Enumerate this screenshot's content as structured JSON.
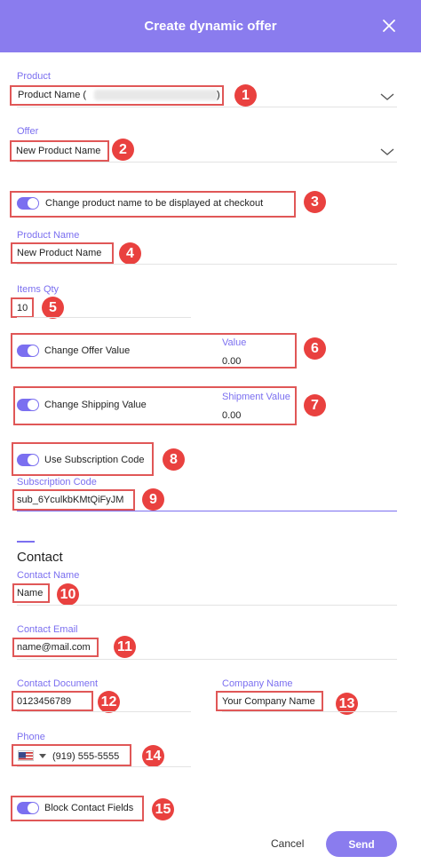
{
  "header": {
    "title": "Create dynamic offer"
  },
  "product": {
    "label": "Product",
    "value": "Product Name ("
  },
  "offer": {
    "label": "Offer",
    "value": "New Product Name"
  },
  "toggles": {
    "change_name": "Change product name to be displayed at checkout",
    "offer_value": "Change Offer Value",
    "shipping_value": "Change Shipping Value",
    "subscription": "Use Subscription Code",
    "block_contact": "Block Contact Fields"
  },
  "product_name": {
    "label": "Product Name",
    "value": "New Product Name"
  },
  "items_qty": {
    "label": "Items Qty",
    "value": "10"
  },
  "value_field": {
    "label": "Value",
    "value": "0.00"
  },
  "shipment_value": {
    "label": "Shipment Value",
    "value": "0.00"
  },
  "subscription_code": {
    "label": "Subscription Code",
    "value": "sub_6YculkbKMtQiFyJM"
  },
  "contact": {
    "title": "Contact"
  },
  "contact_name": {
    "label": "Contact Name",
    "value": "Name"
  },
  "contact_email": {
    "label": "Contact Email",
    "value": "name@mail.com"
  },
  "contact_document": {
    "label": "Contact Document",
    "value": "0123456789"
  },
  "company_name": {
    "label": "Company Name",
    "value": "Your Company Name"
  },
  "phone": {
    "label": "Phone",
    "value": "(919) 555-5555",
    "flag_icon": "us-flag-icon"
  },
  "badges": [
    "1",
    "2",
    "3",
    "4",
    "5",
    "6",
    "7",
    "8",
    "9",
    "10",
    "11",
    "12",
    "13",
    "14",
    "15"
  ],
  "actions": {
    "cancel": "Cancel",
    "send": "Send"
  },
  "colors": {
    "accent": "#8a7cee",
    "highlight": "#e05757",
    "badge": "#e9413f"
  }
}
